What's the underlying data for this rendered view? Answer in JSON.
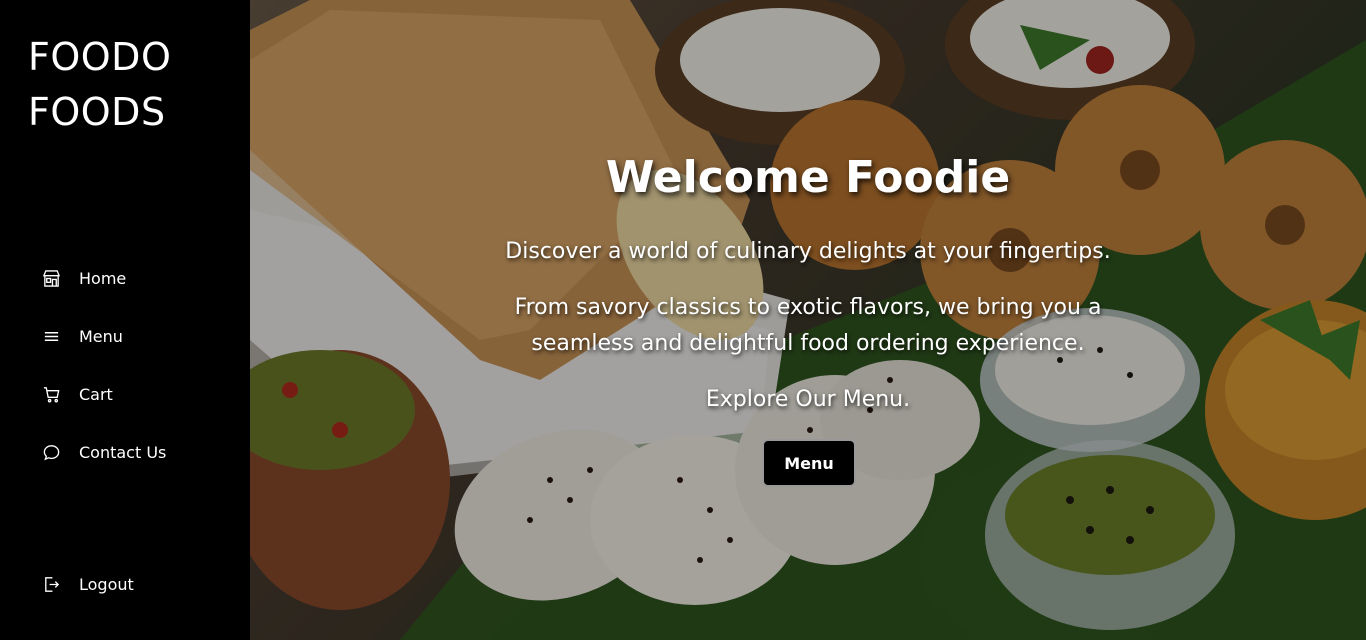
{
  "brand": {
    "line1": "FOODO",
    "line2": "FOODS"
  },
  "sidebar": {
    "items": [
      {
        "label": "Home",
        "icon": "shop-icon"
      },
      {
        "label": "Menu",
        "icon": "hamburger-icon"
      },
      {
        "label": "Cart",
        "icon": "cart-icon"
      },
      {
        "label": "Contact Us",
        "icon": "chat-icon"
      }
    ],
    "logout": {
      "label": "Logout",
      "icon": "logout-icon"
    }
  },
  "hero": {
    "title": "Welcome Foodie",
    "line1": "Discover a world of culinary delights at your fingertips.",
    "line2": "From savory classics to exotic flavors, we bring you a seamless and delightful food ordering experience.",
    "line3": "Explore Our Menu.",
    "button": "Menu",
    "image": "south-indian-breakfast-photo"
  },
  "colors": {
    "sidebar_bg": "#000000",
    "text": "#ffffff",
    "button_bg": "#000000"
  }
}
